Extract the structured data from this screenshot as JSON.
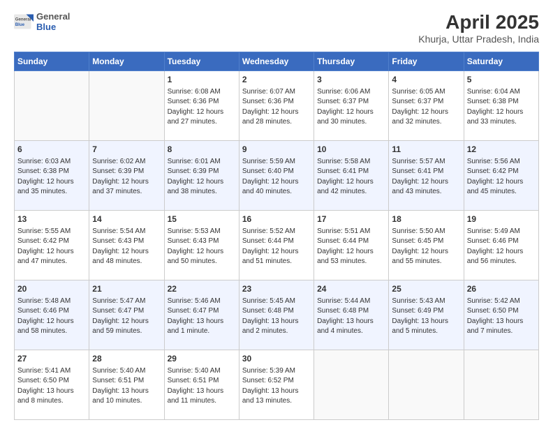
{
  "header": {
    "logo_general": "General",
    "logo_blue": "Blue",
    "title": "April 2025",
    "subtitle": "Khurja, Uttar Pradesh, India"
  },
  "weekdays": [
    "Sunday",
    "Monday",
    "Tuesday",
    "Wednesday",
    "Thursday",
    "Friday",
    "Saturday"
  ],
  "weeks": [
    [
      {
        "day": "",
        "info": ""
      },
      {
        "day": "",
        "info": ""
      },
      {
        "day": "1",
        "info": "Sunrise: 6:08 AM\nSunset: 6:36 PM\nDaylight: 12 hours and 27 minutes."
      },
      {
        "day": "2",
        "info": "Sunrise: 6:07 AM\nSunset: 6:36 PM\nDaylight: 12 hours and 28 minutes."
      },
      {
        "day": "3",
        "info": "Sunrise: 6:06 AM\nSunset: 6:37 PM\nDaylight: 12 hours and 30 minutes."
      },
      {
        "day": "4",
        "info": "Sunrise: 6:05 AM\nSunset: 6:37 PM\nDaylight: 12 hours and 32 minutes."
      },
      {
        "day": "5",
        "info": "Sunrise: 6:04 AM\nSunset: 6:38 PM\nDaylight: 12 hours and 33 minutes."
      }
    ],
    [
      {
        "day": "6",
        "info": "Sunrise: 6:03 AM\nSunset: 6:38 PM\nDaylight: 12 hours and 35 minutes."
      },
      {
        "day": "7",
        "info": "Sunrise: 6:02 AM\nSunset: 6:39 PM\nDaylight: 12 hours and 37 minutes."
      },
      {
        "day": "8",
        "info": "Sunrise: 6:01 AM\nSunset: 6:39 PM\nDaylight: 12 hours and 38 minutes."
      },
      {
        "day": "9",
        "info": "Sunrise: 5:59 AM\nSunset: 6:40 PM\nDaylight: 12 hours and 40 minutes."
      },
      {
        "day": "10",
        "info": "Sunrise: 5:58 AM\nSunset: 6:41 PM\nDaylight: 12 hours and 42 minutes."
      },
      {
        "day": "11",
        "info": "Sunrise: 5:57 AM\nSunset: 6:41 PM\nDaylight: 12 hours and 43 minutes."
      },
      {
        "day": "12",
        "info": "Sunrise: 5:56 AM\nSunset: 6:42 PM\nDaylight: 12 hours and 45 minutes."
      }
    ],
    [
      {
        "day": "13",
        "info": "Sunrise: 5:55 AM\nSunset: 6:42 PM\nDaylight: 12 hours and 47 minutes."
      },
      {
        "day": "14",
        "info": "Sunrise: 5:54 AM\nSunset: 6:43 PM\nDaylight: 12 hours and 48 minutes."
      },
      {
        "day": "15",
        "info": "Sunrise: 5:53 AM\nSunset: 6:43 PM\nDaylight: 12 hours and 50 minutes."
      },
      {
        "day": "16",
        "info": "Sunrise: 5:52 AM\nSunset: 6:44 PM\nDaylight: 12 hours and 51 minutes."
      },
      {
        "day": "17",
        "info": "Sunrise: 5:51 AM\nSunset: 6:44 PM\nDaylight: 12 hours and 53 minutes."
      },
      {
        "day": "18",
        "info": "Sunrise: 5:50 AM\nSunset: 6:45 PM\nDaylight: 12 hours and 55 minutes."
      },
      {
        "day": "19",
        "info": "Sunrise: 5:49 AM\nSunset: 6:46 PM\nDaylight: 12 hours and 56 minutes."
      }
    ],
    [
      {
        "day": "20",
        "info": "Sunrise: 5:48 AM\nSunset: 6:46 PM\nDaylight: 12 hours and 58 minutes."
      },
      {
        "day": "21",
        "info": "Sunrise: 5:47 AM\nSunset: 6:47 PM\nDaylight: 12 hours and 59 minutes."
      },
      {
        "day": "22",
        "info": "Sunrise: 5:46 AM\nSunset: 6:47 PM\nDaylight: 13 hours and 1 minute."
      },
      {
        "day": "23",
        "info": "Sunrise: 5:45 AM\nSunset: 6:48 PM\nDaylight: 13 hours and 2 minutes."
      },
      {
        "day": "24",
        "info": "Sunrise: 5:44 AM\nSunset: 6:48 PM\nDaylight: 13 hours and 4 minutes."
      },
      {
        "day": "25",
        "info": "Sunrise: 5:43 AM\nSunset: 6:49 PM\nDaylight: 13 hours and 5 minutes."
      },
      {
        "day": "26",
        "info": "Sunrise: 5:42 AM\nSunset: 6:50 PM\nDaylight: 13 hours and 7 minutes."
      }
    ],
    [
      {
        "day": "27",
        "info": "Sunrise: 5:41 AM\nSunset: 6:50 PM\nDaylight: 13 hours and 8 minutes."
      },
      {
        "day": "28",
        "info": "Sunrise: 5:40 AM\nSunset: 6:51 PM\nDaylight: 13 hours and 10 minutes."
      },
      {
        "day": "29",
        "info": "Sunrise: 5:40 AM\nSunset: 6:51 PM\nDaylight: 13 hours and 11 minutes."
      },
      {
        "day": "30",
        "info": "Sunrise: 5:39 AM\nSunset: 6:52 PM\nDaylight: 13 hours and 13 minutes."
      },
      {
        "day": "",
        "info": ""
      },
      {
        "day": "",
        "info": ""
      },
      {
        "day": "",
        "info": ""
      }
    ]
  ]
}
